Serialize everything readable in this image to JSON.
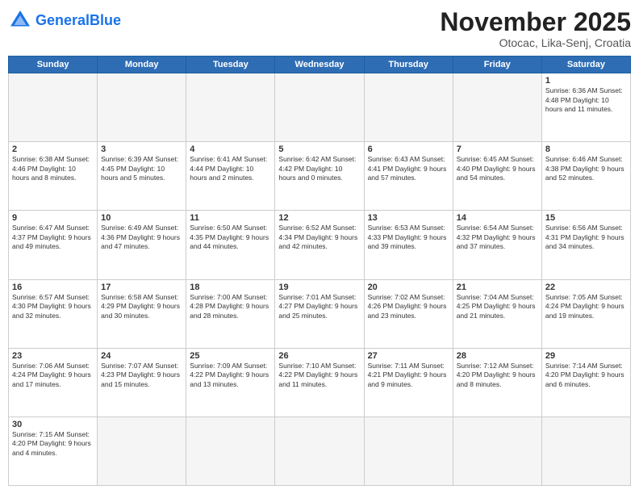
{
  "logo": {
    "text_general": "General",
    "text_blue": "Blue"
  },
  "header": {
    "month": "November 2025",
    "location": "Otocac, Lika-Senj, Croatia"
  },
  "weekdays": [
    "Sunday",
    "Monday",
    "Tuesday",
    "Wednesday",
    "Thursday",
    "Friday",
    "Saturday"
  ],
  "weeks": [
    [
      {
        "day": "",
        "info": ""
      },
      {
        "day": "",
        "info": ""
      },
      {
        "day": "",
        "info": ""
      },
      {
        "day": "",
        "info": ""
      },
      {
        "day": "",
        "info": ""
      },
      {
        "day": "",
        "info": ""
      },
      {
        "day": "1",
        "info": "Sunrise: 6:36 AM\nSunset: 4:48 PM\nDaylight: 10 hours and 11 minutes."
      }
    ],
    [
      {
        "day": "2",
        "info": "Sunrise: 6:38 AM\nSunset: 4:46 PM\nDaylight: 10 hours and 8 minutes."
      },
      {
        "day": "3",
        "info": "Sunrise: 6:39 AM\nSunset: 4:45 PM\nDaylight: 10 hours and 5 minutes."
      },
      {
        "day": "4",
        "info": "Sunrise: 6:41 AM\nSunset: 4:44 PM\nDaylight: 10 hours and 2 minutes."
      },
      {
        "day": "5",
        "info": "Sunrise: 6:42 AM\nSunset: 4:42 PM\nDaylight: 10 hours and 0 minutes."
      },
      {
        "day": "6",
        "info": "Sunrise: 6:43 AM\nSunset: 4:41 PM\nDaylight: 9 hours and 57 minutes."
      },
      {
        "day": "7",
        "info": "Sunrise: 6:45 AM\nSunset: 4:40 PM\nDaylight: 9 hours and 54 minutes."
      },
      {
        "day": "8",
        "info": "Sunrise: 6:46 AM\nSunset: 4:38 PM\nDaylight: 9 hours and 52 minutes."
      }
    ],
    [
      {
        "day": "9",
        "info": "Sunrise: 6:47 AM\nSunset: 4:37 PM\nDaylight: 9 hours and 49 minutes."
      },
      {
        "day": "10",
        "info": "Sunrise: 6:49 AM\nSunset: 4:36 PM\nDaylight: 9 hours and 47 minutes."
      },
      {
        "day": "11",
        "info": "Sunrise: 6:50 AM\nSunset: 4:35 PM\nDaylight: 9 hours and 44 minutes."
      },
      {
        "day": "12",
        "info": "Sunrise: 6:52 AM\nSunset: 4:34 PM\nDaylight: 9 hours and 42 minutes."
      },
      {
        "day": "13",
        "info": "Sunrise: 6:53 AM\nSunset: 4:33 PM\nDaylight: 9 hours and 39 minutes."
      },
      {
        "day": "14",
        "info": "Sunrise: 6:54 AM\nSunset: 4:32 PM\nDaylight: 9 hours and 37 minutes."
      },
      {
        "day": "15",
        "info": "Sunrise: 6:56 AM\nSunset: 4:31 PM\nDaylight: 9 hours and 34 minutes."
      }
    ],
    [
      {
        "day": "16",
        "info": "Sunrise: 6:57 AM\nSunset: 4:30 PM\nDaylight: 9 hours and 32 minutes."
      },
      {
        "day": "17",
        "info": "Sunrise: 6:58 AM\nSunset: 4:29 PM\nDaylight: 9 hours and 30 minutes."
      },
      {
        "day": "18",
        "info": "Sunrise: 7:00 AM\nSunset: 4:28 PM\nDaylight: 9 hours and 28 minutes."
      },
      {
        "day": "19",
        "info": "Sunrise: 7:01 AM\nSunset: 4:27 PM\nDaylight: 9 hours and 25 minutes."
      },
      {
        "day": "20",
        "info": "Sunrise: 7:02 AM\nSunset: 4:26 PM\nDaylight: 9 hours and 23 minutes."
      },
      {
        "day": "21",
        "info": "Sunrise: 7:04 AM\nSunset: 4:25 PM\nDaylight: 9 hours and 21 minutes."
      },
      {
        "day": "22",
        "info": "Sunrise: 7:05 AM\nSunset: 4:24 PM\nDaylight: 9 hours and 19 minutes."
      }
    ],
    [
      {
        "day": "23",
        "info": "Sunrise: 7:06 AM\nSunset: 4:24 PM\nDaylight: 9 hours and 17 minutes."
      },
      {
        "day": "24",
        "info": "Sunrise: 7:07 AM\nSunset: 4:23 PM\nDaylight: 9 hours and 15 minutes."
      },
      {
        "day": "25",
        "info": "Sunrise: 7:09 AM\nSunset: 4:22 PM\nDaylight: 9 hours and 13 minutes."
      },
      {
        "day": "26",
        "info": "Sunrise: 7:10 AM\nSunset: 4:22 PM\nDaylight: 9 hours and 11 minutes."
      },
      {
        "day": "27",
        "info": "Sunrise: 7:11 AM\nSunset: 4:21 PM\nDaylight: 9 hours and 9 minutes."
      },
      {
        "day": "28",
        "info": "Sunrise: 7:12 AM\nSunset: 4:20 PM\nDaylight: 9 hours and 8 minutes."
      },
      {
        "day": "29",
        "info": "Sunrise: 7:14 AM\nSunset: 4:20 PM\nDaylight: 9 hours and 6 minutes."
      }
    ],
    [
      {
        "day": "30",
        "info": "Sunrise: 7:15 AM\nSunset: 4:20 PM\nDaylight: 9 hours and 4 minutes."
      },
      {
        "day": "",
        "info": ""
      },
      {
        "day": "",
        "info": ""
      },
      {
        "day": "",
        "info": ""
      },
      {
        "day": "",
        "info": ""
      },
      {
        "day": "",
        "info": ""
      },
      {
        "day": "",
        "info": ""
      }
    ]
  ]
}
